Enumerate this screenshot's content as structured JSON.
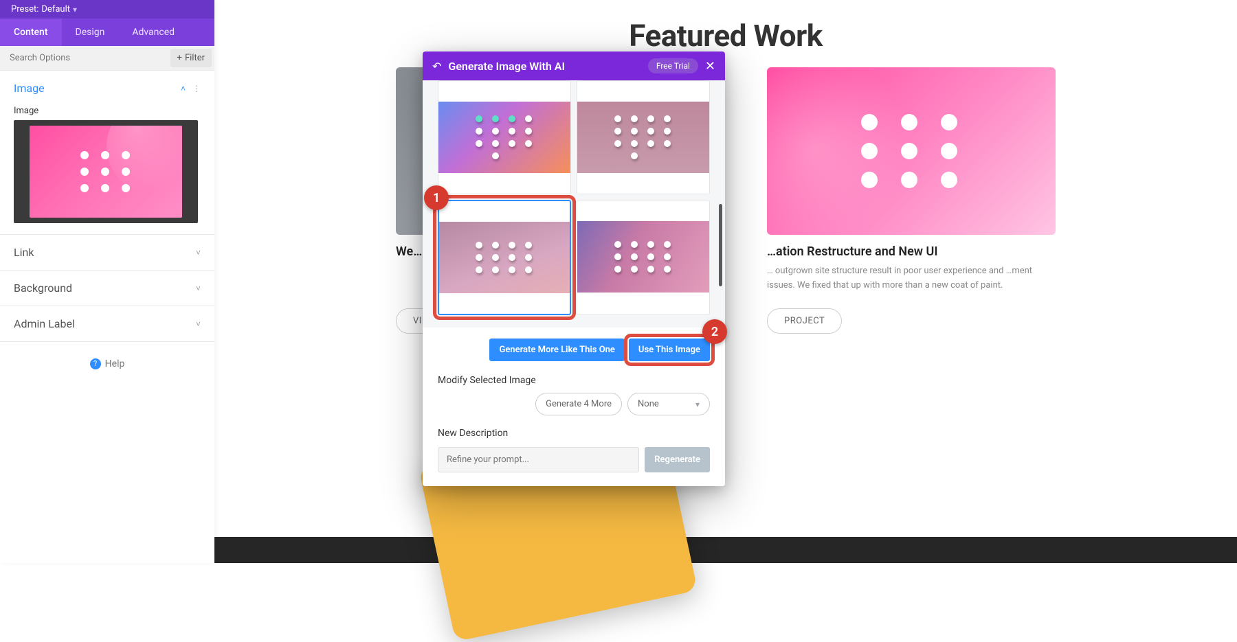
{
  "sidebar": {
    "preset_label": "Preset:",
    "preset_value": "Default",
    "tabs": [
      "Content",
      "Design",
      "Advanced"
    ],
    "search_placeholder": "Search Options",
    "filter_label": "Filter",
    "sections": {
      "image": {
        "title": "Image",
        "sub_label": "Image"
      },
      "link": {
        "title": "Link"
      },
      "background": {
        "title": "Background"
      },
      "admin_label": {
        "title": "Admin Label"
      }
    },
    "help_label": "Help"
  },
  "canvas": {
    "heading": "Featured Work",
    "cards": [
      {
        "title": "We…",
        "desc": "",
        "button": "VIEW"
      },
      {
        "title": "…",
        "desc": "",
        "button": ""
      },
      {
        "title": "…ation Restructure and New UI",
        "desc": "… outgrown site structure result in poor user experience and …ment issues. We fixed that up with more than a new coat of paint.",
        "button": "PROJECT"
      }
    ]
  },
  "modal": {
    "title": "Generate Image With AI",
    "free_trial": "Free Trial",
    "btn_more": "Generate More Like This One",
    "btn_use": "Use This Image",
    "modify_label": "Modify Selected Image",
    "gen4": "Generate 4 More",
    "select_value": "None",
    "new_desc_label": "New Description",
    "prompt_placeholder": "Refine your prompt...",
    "regenerate": "Regenerate"
  },
  "callouts": {
    "one": "1",
    "two": "2"
  }
}
